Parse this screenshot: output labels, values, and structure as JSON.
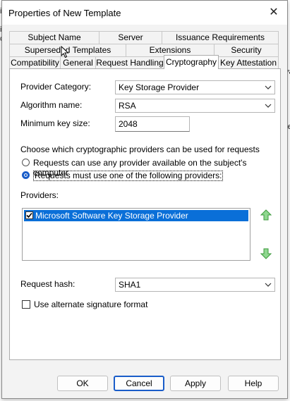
{
  "dialog": {
    "title": "Properties of New Template",
    "close_glyph": "✕"
  },
  "tabs_row1": [
    "Subject Name",
    "Server",
    "Issuance Requirements"
  ],
  "tabs_row2": [
    "Superseded Templates",
    "Extensions",
    "Security"
  ],
  "tabs_row3": [
    "Compatibility",
    "General",
    "Request Handling",
    "Cryptography",
    "Key Attestation"
  ],
  "active_tab": "Cryptography",
  "form": {
    "provider_category_label": "Provider Category:",
    "provider_category_value": "Key Storage Provider",
    "algorithm_label": "Algorithm name:",
    "algorithm_value": "RSA",
    "min_key_label": "Minimum key size:",
    "min_key_value": "2048",
    "choose_label": "Choose which cryptographic providers can be used for requests",
    "radio_any": "Requests can use any provider available on the subject's computer",
    "radio_following": "Requests must use one of the following providers:",
    "providers_label": "Providers:",
    "providers": [
      {
        "name": "Microsoft Software Key Storage Provider",
        "checked": true
      }
    ],
    "request_hash_label": "Request hash:",
    "request_hash_value": "SHA1",
    "alt_sig_label": "Use alternate signature format"
  },
  "buttons": {
    "ok": "OK",
    "cancel": "Cancel",
    "apply": "Apply",
    "help": "Help"
  },
  "icons": {
    "up": "▲",
    "down": "▼",
    "chevron": "⌄"
  }
}
